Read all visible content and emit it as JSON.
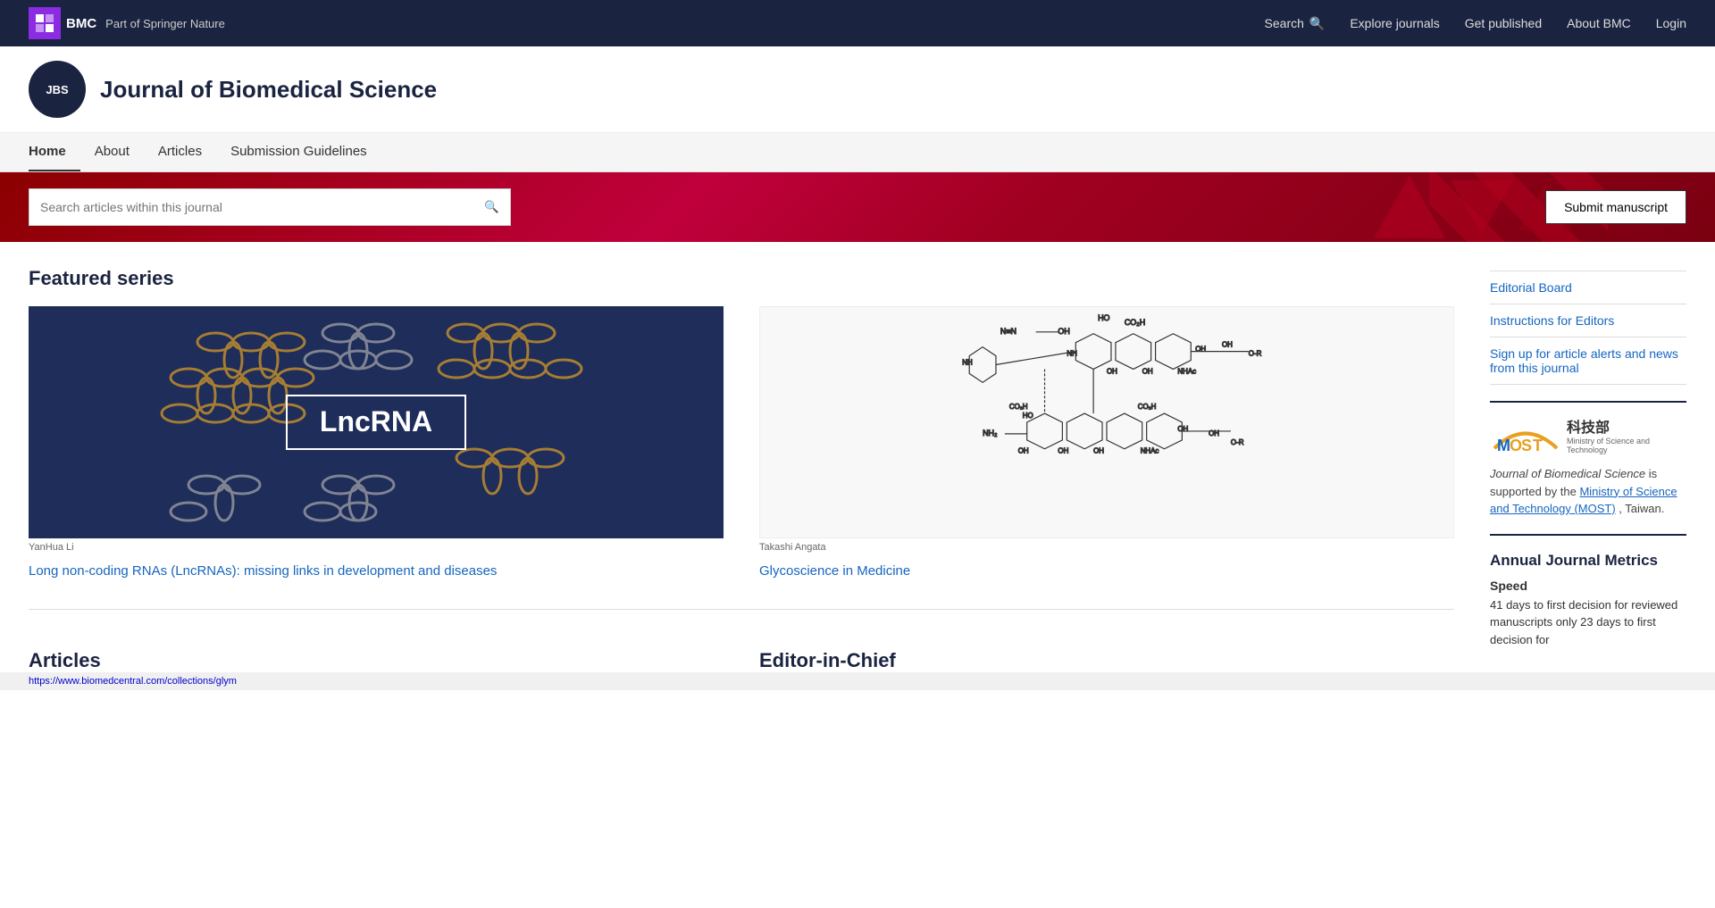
{
  "topNav": {
    "logoText": "BMC",
    "springerText": "Part of Springer Nature",
    "links": [
      {
        "label": "Search",
        "icon": "search-icon"
      },
      {
        "label": "Explore journals"
      },
      {
        "label": "Get published"
      },
      {
        "label": "About BMC"
      },
      {
        "label": "Login"
      }
    ]
  },
  "journalHeader": {
    "logoText": "JBS",
    "title": "Journal of Biomedical Science"
  },
  "secondaryNav": {
    "items": [
      {
        "label": "Home",
        "active": true
      },
      {
        "label": "About"
      },
      {
        "label": "Articles"
      },
      {
        "label": "Submission Guidelines"
      }
    ]
  },
  "searchBanner": {
    "placeholder": "Search articles within this journal",
    "submitLabel": "Submit manuscript"
  },
  "featuredSeries": {
    "sectionTitle": "Featured series",
    "items": [
      {
        "imageCaption": "YanHua Li",
        "linkText": "Long non-coding RNAs (LncRNAs): missing links in development and diseases",
        "type": "lncrna"
      },
      {
        "imageCaption": "Takashi Angata",
        "linkText": "Glycoscience in Medicine",
        "type": "glyco"
      }
    ]
  },
  "articlesSection": {
    "title": "Articles"
  },
  "editorSection": {
    "title": "Editor-in-Chief"
  },
  "sidebar": {
    "links": [
      {
        "label": "Editorial Board"
      },
      {
        "label": "Instructions for Editors"
      },
      {
        "label": "Sign up for article alerts and news from this journal"
      }
    ],
    "mostLogo": {
      "text": "MOST",
      "chinese": "科技部",
      "subtitle": "Ministry of Science and Technology"
    },
    "mostDescription": "Journal of Biomedical Science is supported by the ",
    "mostLinkText": "Ministry of Science and Technology (MOST)",
    "mostDescriptionEnd": ", Taiwan.",
    "annualMetrics": {
      "title": "Annual Journal Metrics",
      "speedTitle": "Speed",
      "speedText": "41 days to first decision for reviewed manuscripts only 23 days to first decision for"
    }
  },
  "statusBar": {
    "url": "https://www.biomedcentral.com/collections/glym"
  }
}
